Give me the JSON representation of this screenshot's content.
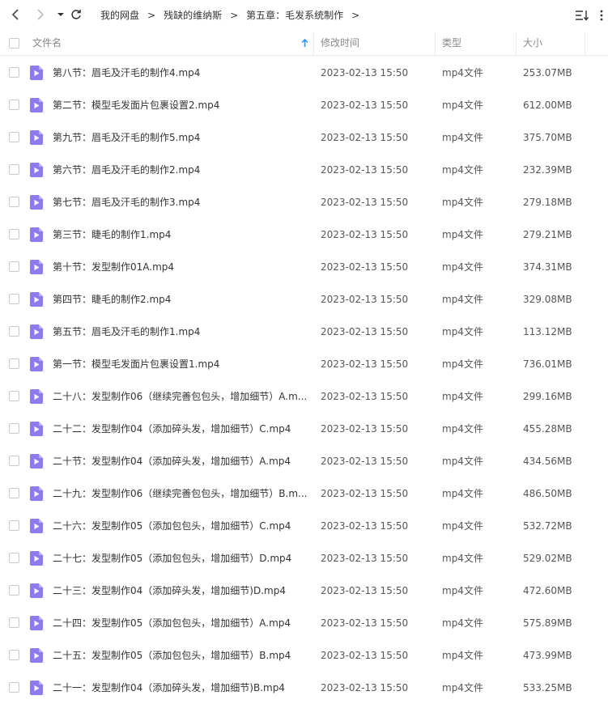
{
  "toolbar": {
    "back_icon": "chevron-left-icon",
    "forward_icon": "chevron-right-icon",
    "dropdown_icon": "caret-down-icon",
    "refresh_icon": "refresh-icon",
    "breadcrumb": [
      "我的网盘",
      "残缺的维纳斯",
      "第五章：毛发系统制作"
    ],
    "separator": ">",
    "sort_icon": "sort-icon"
  },
  "columns": {
    "name": "文件名",
    "modified": "修改时间",
    "type": "类型",
    "size": "大小",
    "sort_indicator_icon": "arrow-up-icon"
  },
  "colors": {
    "file_icon": "#8d7cf0",
    "sort_arrow": "#2f8fe8"
  },
  "files": [
    {
      "name": "第八节：眉毛及汗毛的制作4.mp4",
      "modified": "2023-02-13 15:50",
      "type": "mp4文件",
      "size": "253.07MB"
    },
    {
      "name": "第二节：模型毛发面片包裹设置2.mp4",
      "modified": "2023-02-13 15:50",
      "type": "mp4文件",
      "size": "612.00MB"
    },
    {
      "name": "第九节：眉毛及汗毛的制作5.mp4",
      "modified": "2023-02-13 15:50",
      "type": "mp4文件",
      "size": "375.70MB"
    },
    {
      "name": "第六节：眉毛及汗毛的制作2.mp4",
      "modified": "2023-02-13 15:50",
      "type": "mp4文件",
      "size": "232.39MB"
    },
    {
      "name": "第七节：眉毛及汗毛的制作3.mp4",
      "modified": "2023-02-13 15:50",
      "type": "mp4文件",
      "size": "279.18MB"
    },
    {
      "name": "第三节：睫毛的制作1.mp4",
      "modified": "2023-02-13 15:50",
      "type": "mp4文件",
      "size": "279.21MB"
    },
    {
      "name": "第十节：发型制作01A.mp4",
      "modified": "2023-02-13 15:50",
      "type": "mp4文件",
      "size": "374.31MB"
    },
    {
      "name": "第四节：睫毛的制作2.mp4",
      "modified": "2023-02-13 15:50",
      "type": "mp4文件",
      "size": "329.08MB"
    },
    {
      "name": "第五节：眉毛及汗毛的制作1.mp4",
      "modified": "2023-02-13 15:50",
      "type": "mp4文件",
      "size": "113.12MB"
    },
    {
      "name": "第一节：模型毛发面片包裹设置1.mp4",
      "modified": "2023-02-13 15:50",
      "type": "mp4文件",
      "size": "736.01MB"
    },
    {
      "name": "二十八：发型制作06（继续完善包包头，增加细节）A.m...",
      "modified": "2023-02-13 15:50",
      "type": "mp4文件",
      "size": "299.16MB"
    },
    {
      "name": "二十二：发型制作04（添加碎头发，增加细节）C.mp4",
      "modified": "2023-02-13 15:50",
      "type": "mp4文件",
      "size": "455.28MB"
    },
    {
      "name": "二十节：发型制作04（添加碎头发，增加细节）A.mp4",
      "modified": "2023-02-13 15:50",
      "type": "mp4文件",
      "size": "434.56MB"
    },
    {
      "name": "二十九：发型制作06（继续完善包包头，增加细节）B.m...",
      "modified": "2023-02-13 15:50",
      "type": "mp4文件",
      "size": "486.50MB"
    },
    {
      "name": "二十六：发型制作05（添加包包头，增加细节）C.mp4",
      "modified": "2023-02-13 15:50",
      "type": "mp4文件",
      "size": "532.72MB"
    },
    {
      "name": "二十七：发型制作05（添加包包头，增加细节）D.mp4",
      "modified": "2023-02-13 15:50",
      "type": "mp4文件",
      "size": "529.02MB"
    },
    {
      "name": "二十三：发型制作04（添加碎头发，增加细节)D.mp4",
      "modified": "2023-02-13 15:50",
      "type": "mp4文件",
      "size": "472.60MB"
    },
    {
      "name": "二十四：发型制作05（添加包包头，增加细节）A.mp4",
      "modified": "2023-02-13 15:50",
      "type": "mp4文件",
      "size": "575.89MB"
    },
    {
      "name": "二十五：发型制作05（添加包包头，增加细节）B.mp4",
      "modified": "2023-02-13 15:50",
      "type": "mp4文件",
      "size": "473.99MB"
    },
    {
      "name": "二十一：发型制作04（添加碎头发，增加细节)B.mp4",
      "modified": "2023-02-13 15:50",
      "type": "mp4文件",
      "size": "533.25MB"
    }
  ]
}
